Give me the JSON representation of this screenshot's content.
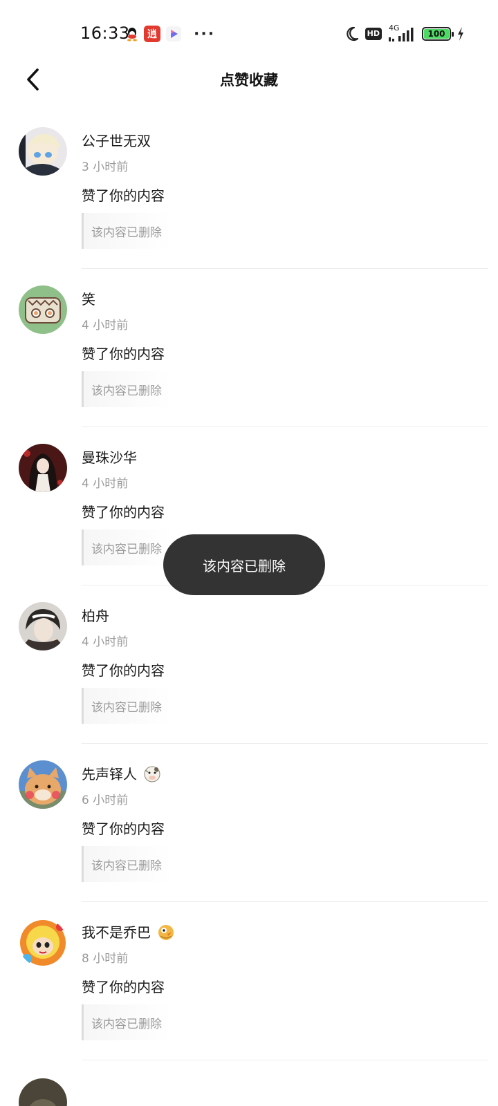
{
  "status_bar": {
    "time": "16:33",
    "hd": "HD",
    "network": "4G",
    "battery": "100",
    "app_badge": "逍"
  },
  "header": {
    "title": "点赞收藏"
  },
  "notifications": [
    {
      "name": "公子世无双",
      "time": "3 小时前",
      "action": "赞了你的内容",
      "quote": "该内容已删除"
    },
    {
      "name": "笑",
      "time": "4 小时前",
      "action": "赞了你的内容",
      "quote": "该内容已删除"
    },
    {
      "name": "曼珠沙华",
      "time": "4 小时前",
      "action": "赞了你的内容",
      "quote": "该内容已删除"
    },
    {
      "name": "柏舟",
      "time": "4 小时前",
      "action": "赞了你的内容",
      "quote": "该内容已删除"
    },
    {
      "name": "先声铎人",
      "time": "6 小时前",
      "action": "赞了你的内容",
      "quote": "该内容已删除"
    },
    {
      "name": "我不是乔巴",
      "time": "8 小时前",
      "action": "赞了你的内容",
      "quote": "该内容已删除"
    }
  ],
  "toast": {
    "message": "该内容已删除"
  },
  "colors": {
    "toast_bg": "#333333",
    "muted_text": "#9a9a9a",
    "battery_green": "#4cd964"
  }
}
